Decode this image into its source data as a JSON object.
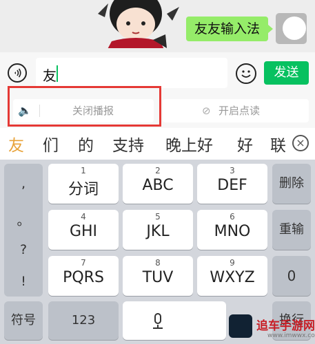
{
  "chat": {
    "message": "友友输入法"
  },
  "input": {
    "typed_text": "友",
    "send_label": "发送"
  },
  "broadcast": {
    "off_label": "关闭播报",
    "read_label": "开启点读"
  },
  "candidates": [
    "友",
    "们",
    "的",
    "支持",
    "晚上好",
    "好",
    "联"
  ],
  "keyboard": {
    "punct": [
      ",",
      "。",
      "?",
      "!"
    ],
    "keys": [
      {
        "num": "1",
        "label": "分词"
      },
      {
        "num": "2",
        "label": "ABC"
      },
      {
        "num": "3",
        "label": "DEF"
      },
      {
        "num": "4",
        "label": "GHI"
      },
      {
        "num": "5",
        "label": "JKL"
      },
      {
        "num": "6",
        "label": "MNO"
      },
      {
        "num": "7",
        "label": "PQRS"
      },
      {
        "num": "8",
        "label": "TUV"
      },
      {
        "num": "9",
        "label": "WXYZ"
      }
    ],
    "delete_label": "删除",
    "reenter_label": "重输",
    "zero_label": "0",
    "symbols_label": "符号",
    "numbers_label": "123",
    "enter_label": "换行"
  },
  "watermark": {
    "text": "追车手游网",
    "url": "www.imwwx.com"
  },
  "colors": {
    "accent": "#07c160",
    "bubble": "#95ec69",
    "highlight": "#e53935"
  }
}
